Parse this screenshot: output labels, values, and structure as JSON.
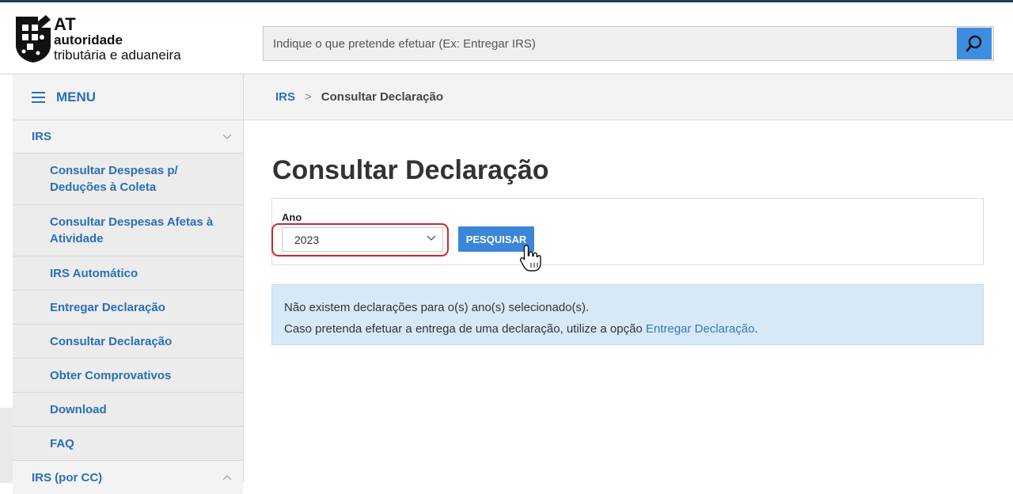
{
  "header": {
    "logo": {
      "line1": "AT",
      "line2": "autoridade",
      "line3": "tributária e aduaneira"
    },
    "search": {
      "placeholder": "Indique o que pretende efetuar (Ex: Entregar IRS)"
    }
  },
  "sidebar": {
    "menu_label": "MENU",
    "group_irs": "IRS",
    "items": [
      "Consultar Despesas p/ Deduções à Coleta",
      "Consultar Despesas Afetas à Atividade",
      "IRS Automático",
      "Entregar Declaração",
      "Consultar Declaração",
      "Obter Comprovativos",
      "Download",
      "FAQ"
    ],
    "group_irs_cc": "IRS (por CC)"
  },
  "breadcrumb": {
    "root": "IRS",
    "separator": ">",
    "current": "Consultar Declaração"
  },
  "main": {
    "title": "Consultar Declaração",
    "form": {
      "label": "Ano",
      "selected_year": "2023",
      "button": "PESQUISAR"
    },
    "alert": {
      "line1": "Não existem declarações para o(s) ano(s) selecionado(s).",
      "line2_prefix": "Caso pretenda efetuar a entrega de uma declaração, utilize a opção ",
      "line2_link": "Entregar Declaração",
      "line2_suffix": "."
    }
  },
  "colors": {
    "brand_blue": "#2a6fb5",
    "button_blue": "#3b86d8",
    "alert_bg": "#d7e9f7",
    "highlight_red": "#d0252b"
  },
  "icons": [
    "at-logo-icon",
    "search-icon",
    "hamburger-icon",
    "chevron-down-icon",
    "chevron-up-icon",
    "hand-cursor-icon"
  ]
}
